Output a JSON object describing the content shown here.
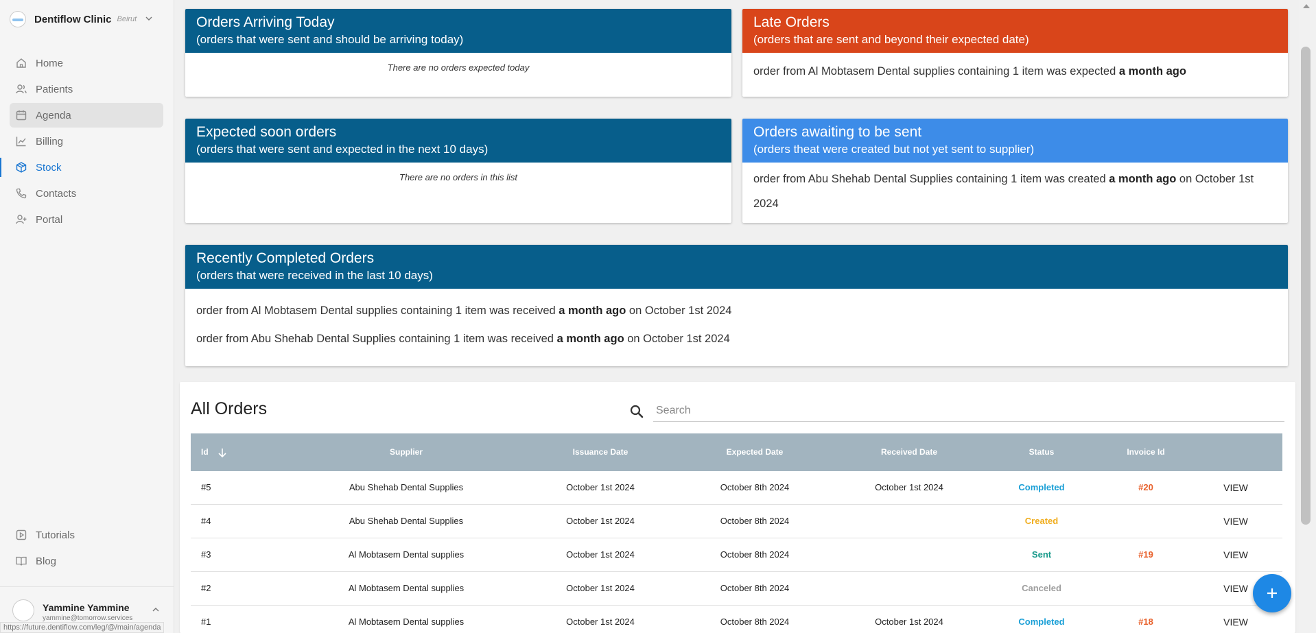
{
  "sidebar": {
    "brand": {
      "name": "Dentiflow Clinic",
      "city": "Beirut"
    },
    "nav": [
      {
        "label": "Home",
        "icon": "home-icon"
      },
      {
        "label": "Patients",
        "icon": "users-icon"
      },
      {
        "label": "Agenda",
        "icon": "calendar-icon"
      },
      {
        "label": "Billing",
        "icon": "chart-line-icon"
      },
      {
        "label": "Stock",
        "icon": "package-icon"
      },
      {
        "label": "Contacts",
        "icon": "phone-icon"
      },
      {
        "label": "Portal",
        "icon": "user-plus-icon"
      }
    ],
    "bottom_nav": [
      {
        "label": "Tutorials",
        "icon": "play-icon"
      },
      {
        "label": "Blog",
        "icon": "book-icon"
      }
    ],
    "user": {
      "name": "Yammine Yammine",
      "email": "yammine@tomorrow.services"
    },
    "status_url": "https://future.dentiflow.com/leg/@/main/agenda"
  },
  "cards": {
    "arriving": {
      "title": "Orders Arriving Today",
      "subtitle": "(orders that were sent and should be arriving today)",
      "empty": "There are no orders expected today"
    },
    "late": {
      "title": "Late Orders",
      "subtitle": "(orders that are sent and beyond their expected date)",
      "line": {
        "pre": "order from Al Mobtasem Dental supplies containing 1 item was  expected ",
        "bold": "a month ago"
      }
    },
    "soon": {
      "title": "Expected soon orders",
      "subtitle": "(orders that were sent and expected in the next 10 days)",
      "empty": "There are no orders in this list"
    },
    "awaiting": {
      "title": "Orders awaiting to be sent",
      "subtitle": "(orders theat were created but not yet sent to supplier)",
      "line": {
        "pre": "order from Abu Shehab Dental Supplies containing 1 item was created ",
        "bold": "a month ago",
        "post": " on October 1st 2024"
      }
    },
    "completed": {
      "title": "Recently Completed Orders",
      "subtitle": "(orders that were received in the last 10 days)",
      "lines": [
        {
          "pre": "order from Al Mobtasem Dental supplies containing 1 item was received ",
          "bold": "a month ago",
          "post": " on October 1st 2024"
        },
        {
          "pre": "order from Abu Shehab Dental Supplies containing 1 item was received ",
          "bold": "a month ago",
          "post": " on October 1st 2024"
        }
      ]
    }
  },
  "orders": {
    "title": "All Orders",
    "search_placeholder": "Search",
    "columns": [
      "Id",
      "Supplier",
      "Issuance Date",
      "Expected Date",
      "Received Date",
      "Status",
      "Invoice Id"
    ],
    "rows": [
      {
        "id": "#5",
        "supplier": "Abu Shehab Dental Supplies",
        "issued": "October 1st 2024",
        "expected": "October 8th 2024",
        "received": "October 1st 2024",
        "status": "Completed",
        "invoice": "#20",
        "action": "VIEW"
      },
      {
        "id": "#4",
        "supplier": "Abu Shehab Dental Supplies",
        "issued": "October 1st 2024",
        "expected": "October 8th 2024",
        "received": "",
        "status": "Created",
        "invoice": "",
        "action": "VIEW"
      },
      {
        "id": "#3",
        "supplier": "Al Mobtasem Dental supplies",
        "issued": "October 1st 2024",
        "expected": "October 8th 2024",
        "received": "",
        "status": "Sent",
        "invoice": "#19",
        "action": "VIEW"
      },
      {
        "id": "#2",
        "supplier": "Al Mobtasem Dental supplies",
        "issued": "October 1st 2024",
        "expected": "October 8th 2024",
        "received": "",
        "status": "Canceled",
        "invoice": "",
        "action": "VIEW"
      },
      {
        "id": "#1",
        "supplier": "Al Mobtasem Dental supplies",
        "issued": "October 1st 2024",
        "expected": "October 8th 2024",
        "received": "October 1st 2024",
        "status": "Completed",
        "invoice": "#18",
        "action": "VIEW"
      }
    ]
  },
  "colors": {
    "header_dark": "#075e8b",
    "header_late": "#d9451a",
    "header_awaiting": "#3d8ce8",
    "status_completed": "#1a9fd6",
    "status_created": "#f0ad1e",
    "status_sent": "#17998a",
    "status_canceled": "#9e9e9e",
    "invoice": "#e8612c",
    "accent": "#1976d2"
  },
  "fab_icon": "plus-icon"
}
